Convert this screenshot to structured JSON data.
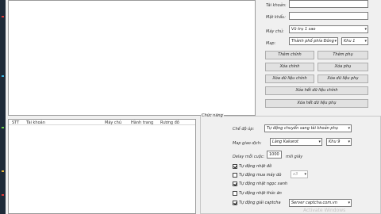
{
  "account_form": {
    "account_label": "Tài khoản:",
    "account_value": "",
    "password_label": "Mật khẩu:",
    "password_value": "",
    "server_label": "Máy chủ:",
    "server_value": "Vũ trụ 1 sao",
    "map_label": "Map:",
    "map_value": "Thành phố phía Đông",
    "zone_value": "Khu 1"
  },
  "buttons": {
    "add_main": "Thêm chính",
    "add_sub": "Thêm phụ",
    "delete_main": "Xóa chính",
    "delete_sub": "Xóa phụ",
    "delete_main_data": "Xóa dữ liệu chính",
    "delete_sub_data": "Xóa dữ liệu phụ",
    "delete_all_main_data": "Xóa hết dữ liệu chính",
    "delete_all_sub_data": "Xóa hết dữ liệu phụ"
  },
  "table": {
    "columns": [
      "STT",
      "Tài khoản",
      "Máy chủ",
      "Hành trang",
      "Rương đồ"
    ]
  },
  "settings": {
    "title": "Chức năng",
    "mode_label": "Chế độ úp:",
    "mode_value": "Tự động chuyển sang tài khoản phụ",
    "trade_map_label": "Map giao dịch:",
    "trade_map_value": "Làng Kakarot",
    "trade_zone_value": "Khu 9",
    "delay_label": "Delay mỗi cuộc:",
    "delay_value": "1000",
    "delay_unit": "mili giây",
    "auto_pickup_label": "Tự động nhặt đồ",
    "auto_pickup_checked": true,
    "auto_buy_items_label": "Tự động mua máy dò",
    "auto_buy_items_checked": false,
    "auto_buy_items_count": "x3",
    "auto_pick_gem_label": "Tự động nhặt ngọc xanh",
    "auto_pick_gem_checked": true,
    "auto_pick_food_label": "Tự động nhặt thức ăn",
    "auto_pick_food_checked": false,
    "auto_captcha_label": "Tự động giải captcha",
    "auto_captcha_checked": true,
    "captcha_server_value": "Server captcha.com.vn"
  },
  "watermark": "Activate Windows",
  "colors": {
    "background": "#f0f0f0",
    "button": "#e1e1e1",
    "border": "#7a7a7a"
  }
}
